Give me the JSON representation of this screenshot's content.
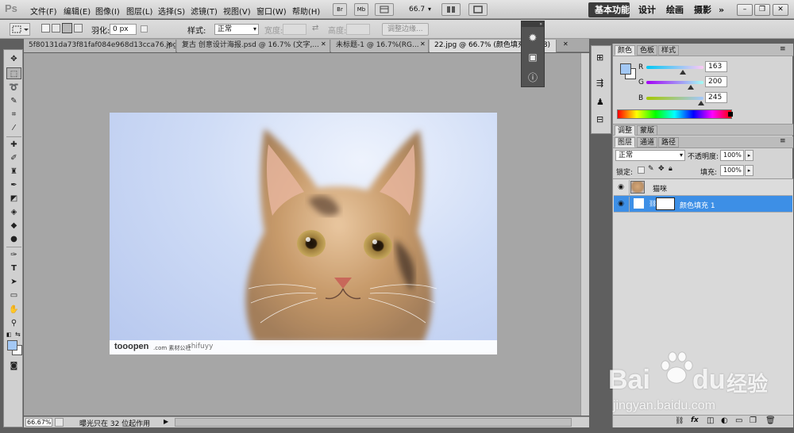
{
  "app": {
    "logo": "Ps"
  },
  "menu": [
    "文件(F)",
    "编辑(E)",
    "图像(I)",
    "图层(L)",
    "选择(S)",
    "滤镜(T)",
    "视图(V)",
    "窗口(W)",
    "帮助(H)"
  ],
  "menubar_buttons": {
    "br": "Br",
    "mb": "Mb",
    "zoom": "66.7",
    "zoom_arrow": "▾"
  },
  "workspaces": {
    "active": "基本功能",
    "design": "设计",
    "paint": "绘画",
    "photo": "摄影",
    "more": "»"
  },
  "window_buttons": {
    "min": "–",
    "restore": "❐",
    "close": "✕"
  },
  "options": {
    "feather_label": "羽化:",
    "feather_value": "0 px",
    "style_label": "样式:",
    "style_value": "正常",
    "width_label": "宽度:",
    "height_label": "高度:",
    "refine_button": "调整边缘..."
  },
  "tabs": [
    {
      "label": "5f80131da73f81faf084e968d13cca76.jpg",
      "close": "✕"
    },
    {
      "label": "复古 创意设计海报.psd @ 16.7% (文字,...",
      "close": "✕"
    },
    {
      "label": "未标题-1 @ 16.7%(RG...",
      "close": "✕"
    },
    {
      "label": "22.jpg @ 66.7% (颜色填充 1, ...8)",
      "close": "✕"
    }
  ],
  "image": {
    "credit_logo": "tooopen",
    "credit_tag": ".com 素材公社",
    "credit_user": "shifuyy"
  },
  "status": {
    "zoom": "66.67%",
    "message": "曝光只在 32 位起作用",
    "arrow": "▶"
  },
  "color_panel": {
    "tabs": [
      "颜色",
      "色板",
      "样式"
    ],
    "channels": [
      {
        "label": "R",
        "value": "163",
        "fraction": 0.64
      },
      {
        "label": "G",
        "value": "200",
        "fraction": 0.78
      },
      {
        "label": "B",
        "value": "245",
        "fraction": 0.96
      }
    ],
    "foreground": "#a3c8f5"
  },
  "adjust_panel": {
    "tabs": [
      "调整",
      "蒙版"
    ]
  },
  "layers_panel": {
    "tabs": [
      "图层",
      "通道",
      "路径"
    ],
    "blend_mode": "正常",
    "opacity_label": "不透明度:",
    "opacity_value": "100%",
    "lock_label": "锁定:",
    "fill_label": "填充:",
    "fill_value": "100%",
    "layers": [
      {
        "name": "猫咪",
        "selected": false
      },
      {
        "name": "颜色填充 1",
        "selected": true
      }
    ],
    "footer_icons": [
      "link-icon",
      "fx-icon",
      "mask-icon",
      "adjustment-icon",
      "group-icon",
      "new-layer-icon",
      "trash-icon"
    ]
  },
  "watermark": {
    "brand": "Bai",
    "brand2": "du",
    "cn": "经验",
    "url": "jingyan.baidu.com"
  },
  "colors": {
    "selection": "#3d8fe6",
    "accent": "#1f7ad9"
  }
}
